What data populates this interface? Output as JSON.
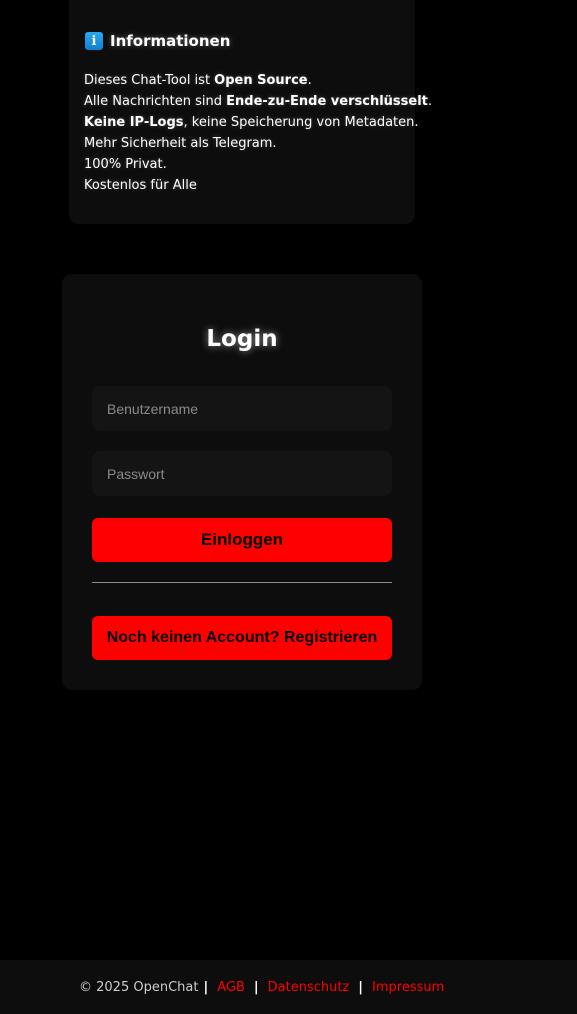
{
  "info": {
    "icon": "info-icon",
    "icon_glyph": "i",
    "title": "Informationen",
    "lines": [
      {
        "a": "Dieses Chat-Tool ist ",
        "b": "Open Source",
        "c": "."
      },
      {
        "a": "Alle Nachrichten sind ",
        "b": "Ende-zu-Ende verschlüsselt",
        "c": "."
      },
      {
        "a": "",
        "b": "Keine IP-Logs",
        "c": ", keine Speicherung von Metadaten."
      },
      {
        "a": "Mehr Sicherheit als Telegram.",
        "b": "",
        "c": ""
      },
      {
        "a": "100% Privat.",
        "b": "",
        "c": ""
      },
      {
        "a": "Kostenlos für Alle",
        "b": "",
        "c": ""
      }
    ]
  },
  "login": {
    "title": "Login",
    "username_placeholder": "Benutzername",
    "password_placeholder": "Passwort",
    "login_button": "Einloggen",
    "register_button": "Noch keinen Account? Registrieren"
  },
  "footer": {
    "copyright": "© 2025 OpenChat",
    "separator": "|",
    "links": [
      "AGB",
      "Datenschutz",
      "Impressum"
    ]
  },
  "colors": {
    "accent": "#ff0000",
    "background": "#000000",
    "card": "#0d0d0d",
    "input": "#141414",
    "info_icon": "#1a96e0"
  }
}
